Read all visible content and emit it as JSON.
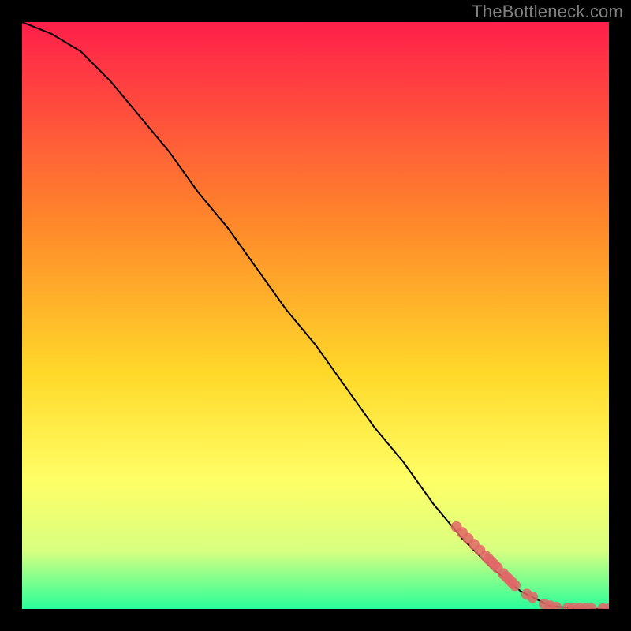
{
  "watermark": "TheBottleneck.com",
  "colors": {
    "background": "#000000",
    "gradient_top": "#ff1f4b",
    "gradient_mid1": "#ff8a2a",
    "gradient_mid2": "#ffd92a",
    "gradient_mid3": "#ffff66",
    "gradient_mid4": "#d8ff80",
    "gradient_bottom": "#2aff9a",
    "curve": "#000000",
    "points": "#e06666"
  },
  "chart_data": {
    "type": "line",
    "title": "",
    "xlabel": "",
    "ylabel": "",
    "xlim": [
      0,
      100
    ],
    "ylim": [
      0,
      100
    ],
    "grid": false,
    "legend": false,
    "curve": {
      "x": [
        0,
        5,
        10,
        15,
        20,
        25,
        30,
        35,
        40,
        45,
        50,
        55,
        60,
        65,
        70,
        75,
        80,
        85,
        90,
        95,
        100
      ],
      "y": [
        100,
        98,
        95,
        90,
        84,
        78,
        71,
        65,
        58,
        51,
        45,
        38,
        31,
        25,
        18,
        12,
        7,
        3,
        0.5,
        0,
        0
      ]
    },
    "scatter": {
      "x": [
        74,
        75,
        76,
        77,
        78,
        79,
        79.5,
        80,
        80.5,
        81,
        82,
        82.5,
        83,
        83.5,
        84,
        86,
        87,
        89,
        90,
        91,
        93,
        94,
        95,
        96,
        97,
        99,
        100
      ],
      "y": [
        14,
        13,
        12,
        11,
        10,
        9,
        8.5,
        8,
        7.5,
        7,
        6,
        5.5,
        5,
        4.5,
        4,
        2.5,
        2,
        0.8,
        0.5,
        0.3,
        0.15,
        0.1,
        0.08,
        0.06,
        0.04,
        0.02,
        0.02
      ]
    }
  }
}
